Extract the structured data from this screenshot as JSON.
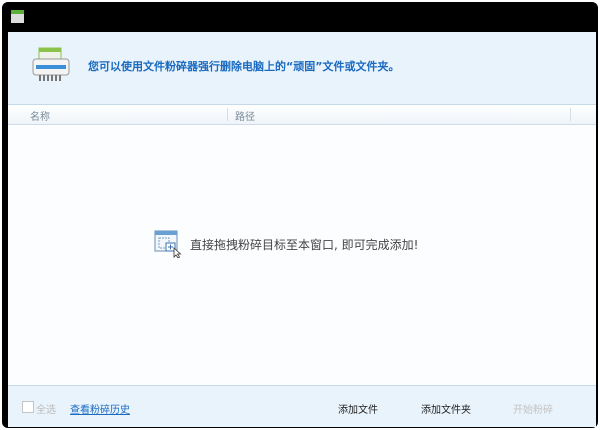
{
  "header": {
    "message": "您可以使用文件粉碎器强行删除电脑上的“顽固”文件或文件夹。"
  },
  "columns": [
    "名称",
    "路径"
  ],
  "empty_hint": "直接拖拽粉碎目标至本窗口, 即可完成添加!",
  "footer": {
    "select_all": "全选",
    "history_link": "查看粉碎历史",
    "add_file": "添加文件",
    "add_folder": "添加文件夹",
    "start": "开始粉碎"
  },
  "colors": {
    "accent": "#1a6ac0",
    "header_bg": "#e8f3fb"
  }
}
